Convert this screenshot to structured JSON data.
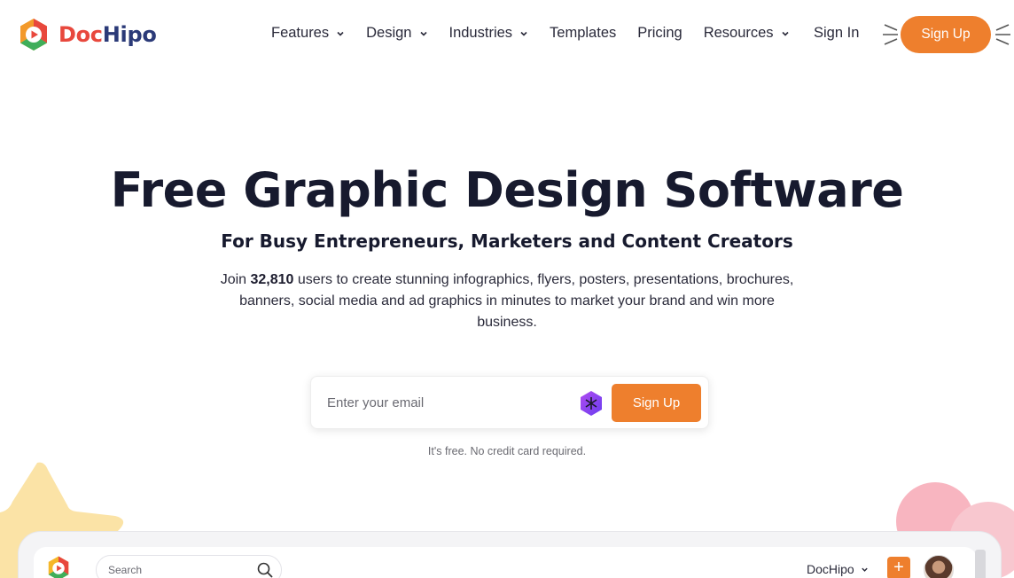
{
  "brand": {
    "name_part1": "Doc",
    "name_part2": "Hipo"
  },
  "nav": {
    "items": [
      {
        "label": "Features",
        "has_dropdown": true
      },
      {
        "label": "Design",
        "has_dropdown": true
      },
      {
        "label": "Industries",
        "has_dropdown": true
      },
      {
        "label": "Templates",
        "has_dropdown": false
      },
      {
        "label": "Pricing",
        "has_dropdown": false
      },
      {
        "label": "Resources",
        "has_dropdown": true
      }
    ],
    "signin_label": "Sign In",
    "signup_label": "Sign Up"
  },
  "hero": {
    "title": "Free Graphic Design Software",
    "subtitle": "For Busy Entrepreneurs, Marketers and Content Creators",
    "desc_prefix": "Join ",
    "user_count": "32,810",
    "desc_suffix": " users to create stunning infographics, flyers, posters, presentations, brochures, banners, social media and ad graphics in minutes to market your brand and win more business.",
    "email_placeholder": "Enter your email",
    "signup_label": "Sign Up",
    "free_note": "It's free. No credit card required."
  },
  "preview": {
    "search_placeholder": "Search",
    "brand_label": "DocHipo",
    "plus_label": "+"
  },
  "colors": {
    "accent": "#ee7f2d",
    "title": "#171a2e",
    "logo_red": "#e8483d",
    "logo_navy": "#2b3a78"
  }
}
